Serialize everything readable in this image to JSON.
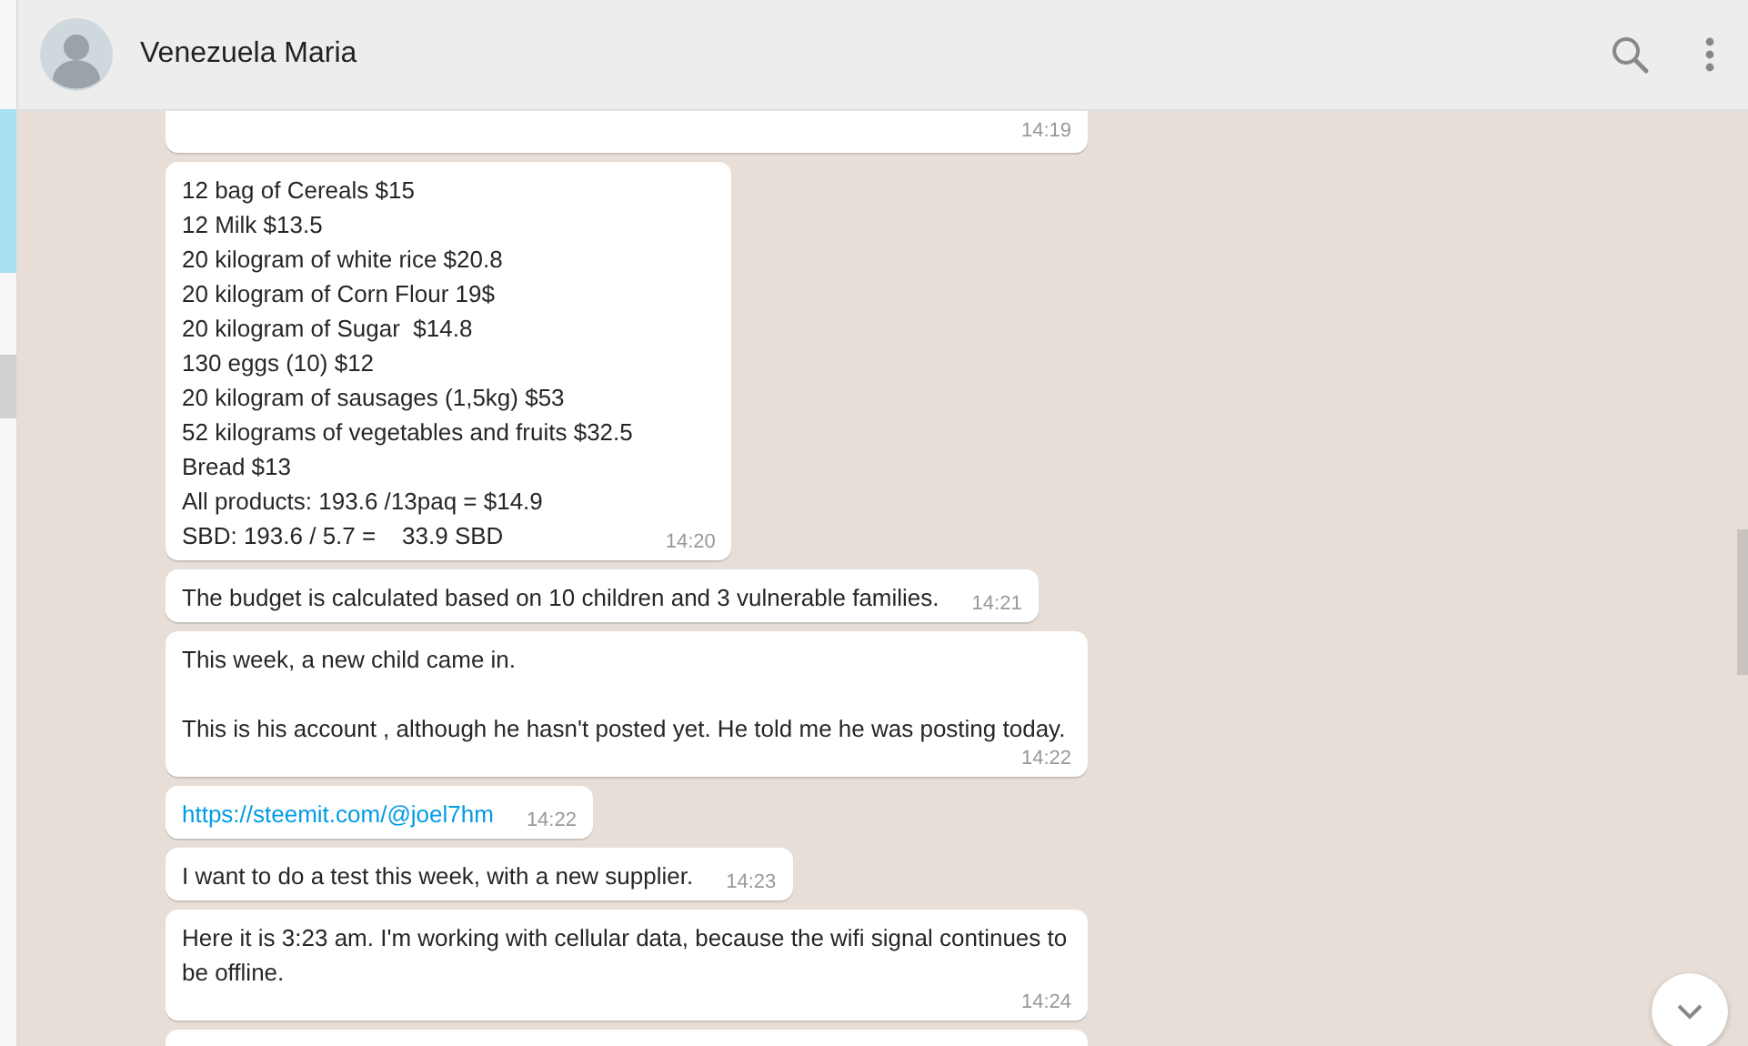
{
  "header": {
    "contact_name": "Venezuela Maria"
  },
  "messages": [
    {
      "kind": "text",
      "time": "14:19"
    },
    {
      "kind": "text",
      "text": "12 bag of Cereals $15\n12 Milk $13.5\n20 kilogram of white rice $20.8\n20 kilogram of Corn Flour 19$\n20 kilogram of Sugar  $14.8\n130 eggs (10) $12\n20 kilogram of sausages (1,5kg) $53\n52 kilograms of vegetables and fruits $32.5\nBread $13\nAll products: 193.6 /13paq = $14.9\nSBD: 193.6 / 5.7 =    33.9 SBD",
      "time": "14:20"
    },
    {
      "kind": "text",
      "text": "The budget is calculated based on 10 children and 3 vulnerable families.",
      "time": "14:21"
    },
    {
      "kind": "text",
      "text": "This week, a new child came in.\n\nThis is his account , although he hasn't posted yet. He told me he was posting today.",
      "time": "14:22"
    },
    {
      "kind": "link",
      "text": "https://steemit.com/@joel7hm",
      "time": "14:22"
    },
    {
      "kind": "text",
      "text": "I want to do a test this week, with a new supplier.",
      "time": "14:23"
    },
    {
      "kind": "text",
      "text": "Here it is 3:23 am. I'm working with cellular data, because the wifi signal continues to be offline.",
      "time": "14:24"
    }
  ]
}
